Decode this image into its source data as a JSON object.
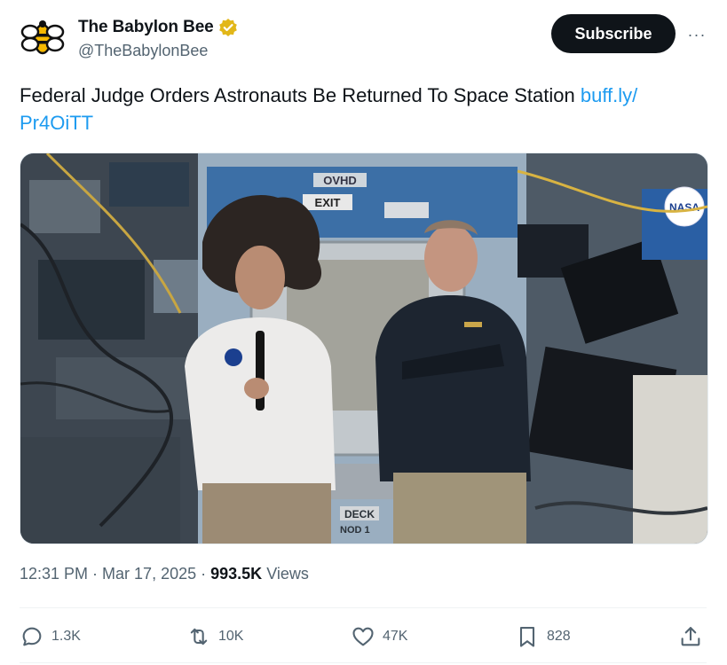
{
  "account": {
    "display_name": "The Babylon Bee",
    "handle": "@TheBabylonBee",
    "verified_icon": "gold-verified-badge",
    "avatar_icon": "babylon-bee-logo"
  },
  "header": {
    "subscribe_label": "Subscribe",
    "more_label": "···"
  },
  "tweet": {
    "text": "Federal Judge Orders Astronauts Be Returned To Space Station ",
    "link_text": "buff.ly/\nPr4OiTT"
  },
  "media": {
    "image_icon": "astronauts-in-space-station-photo",
    "signs": {
      "ovhd": "OVHD",
      "exit": "EXIT",
      "deck": "DECK",
      "nod": "NOD 1",
      "nasa": "NASA"
    }
  },
  "meta": {
    "time": "12:31 PM",
    "separator": " · ",
    "date": "Mar 17, 2025",
    "views_count": "993.5K",
    "views_label": "Views"
  },
  "actions": {
    "replies": "1.3K",
    "reposts": "10K",
    "likes": "47K",
    "bookmarks": "828"
  },
  "colors": {
    "accent": "#1d9bf0",
    "muted": "#536471",
    "text": "#0f1419",
    "verified_gold": "#e2b719"
  }
}
